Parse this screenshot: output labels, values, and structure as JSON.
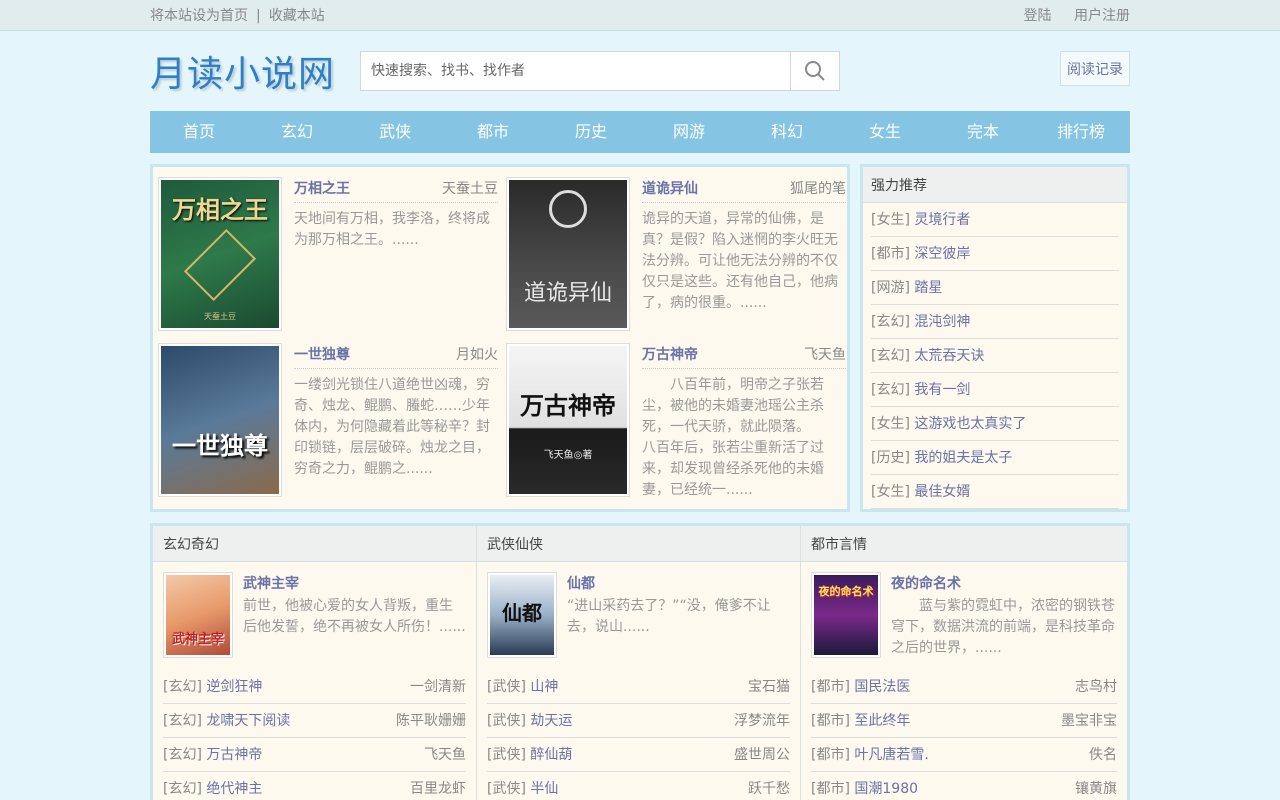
{
  "topbar": {
    "set_home": "将本站设为首页",
    "separator": "|",
    "bookmark": "收藏本站",
    "login": "登陆",
    "register": "用户注册"
  },
  "header": {
    "logo": "月读小说网",
    "search_placeholder": "快速搜索、找书、找作者",
    "history": "阅读记录"
  },
  "nav": [
    "首页",
    "玄幻",
    "武侠",
    "都市",
    "历史",
    "网游",
    "科幻",
    "女生",
    "完本",
    "排行榜"
  ],
  "featured": [
    {
      "title": "万相之王",
      "author": "天蚕土豆",
      "desc": "天地间有万相，我李洛，终将成为那万相之王。......",
      "cover_text": "万相之王",
      "cover_sub": "天蚕土豆"
    },
    {
      "title": "道诡异仙",
      "author": "狐尾的笔",
      "desc": "诡异的天道，异常的仙佛，是真？是假？陷入迷惘的李火旺无法分辨。可让他无法分辨的不仅仅只是这些。还有他自己，他病了，病的很重。......",
      "cover_text": "道诡异仙",
      "cover_sub": ""
    },
    {
      "title": "一世独尊",
      "author": "月如火",
      "desc": "一缕剑光锁住八道绝世凶魂，穷奇、烛龙、鲲鹏、螣蛇……少年体内，为何隐藏着此等秘辛？封印锁链，层层破碎。烛龙之目，穷奇之力，鲲鹏之......",
      "cover_text": "一世独尊",
      "cover_sub": ""
    },
    {
      "title": "万古神帝",
      "author": "飞天鱼",
      "desc": "　　八百年前，明帝之子张若尘，被他的未婚妻池瑶公主杀死，一代天骄，就此陨落。\n八百年后，张若尘重新活了过来，却发现曾经杀死他的未婚妻，已经统一......",
      "cover_text": "万古神帝",
      "cover_sub": "飞天鱼◎著"
    }
  ],
  "recommend": {
    "title": "强力推荐",
    "items": [
      {
        "cat": "[女生]",
        "name": "灵境行者"
      },
      {
        "cat": "[都市]",
        "name": "深空彼岸"
      },
      {
        "cat": "[网游]",
        "name": "踏星"
      },
      {
        "cat": "[玄幻]",
        "name": "混沌剑神"
      },
      {
        "cat": "[玄幻]",
        "name": "太荒吞天诀"
      },
      {
        "cat": "[玄幻]",
        "name": "我有一剑"
      },
      {
        "cat": "[女生]",
        "name": "这游戏也太真实了"
      },
      {
        "cat": "[历史]",
        "name": "我的姐夫是太子"
      },
      {
        "cat": "[女生]",
        "name": "最佳女婿"
      }
    ]
  },
  "columns": [
    {
      "title": "玄幻奇幻",
      "top": {
        "title": "武神主宰",
        "desc": "前世，他被心爱的女人背叛，重生后他发誓，绝不再被女人所伤！......",
        "cover_text": "武神主宰"
      },
      "items": [
        {
          "cat": "[玄幻]",
          "name": "逆剑狂神",
          "author": "一剑清新"
        },
        {
          "cat": "[玄幻]",
          "name": "龙啸天下阅读",
          "author": "陈平耿姗姗"
        },
        {
          "cat": "[玄幻]",
          "name": "万古神帝",
          "author": "飞天鱼"
        },
        {
          "cat": "[玄幻]",
          "name": "绝代神主",
          "author": "百里龙虾"
        }
      ]
    },
    {
      "title": "武侠仙侠",
      "top": {
        "title": "仙都",
        "desc": "“进山采药去了？”“没，俺爹不让去，说山......",
        "cover_text": "仙都"
      },
      "items": [
        {
          "cat": "[武侠]",
          "name": "山神",
          "author": "宝石猫"
        },
        {
          "cat": "[武侠]",
          "name": "劫天运",
          "author": "浮梦流年"
        },
        {
          "cat": "[武侠]",
          "name": "醉仙葫",
          "author": "盛世周公"
        },
        {
          "cat": "[武侠]",
          "name": "半仙",
          "author": "跃千愁"
        }
      ]
    },
    {
      "title": "都市言情",
      "top": {
        "title": "夜的命名术",
        "desc": "　　蓝与紫的霓虹中，浓密的钢铁苍穹下，数据洪流的前端，是科技革命之后的世界，......",
        "cover_text": "夜的命名术"
      },
      "items": [
        {
          "cat": "[都市]",
          "name": "国民法医",
          "author": "志鸟村"
        },
        {
          "cat": "[都市]",
          "name": "至此终年",
          "author": "墨宝非宝"
        },
        {
          "cat": "[都市]",
          "name": "叶凡唐若雪.",
          "author": "佚名"
        },
        {
          "cat": "[都市]",
          "name": "国潮1980",
          "author": "镶黄旗"
        }
      ]
    }
  ]
}
